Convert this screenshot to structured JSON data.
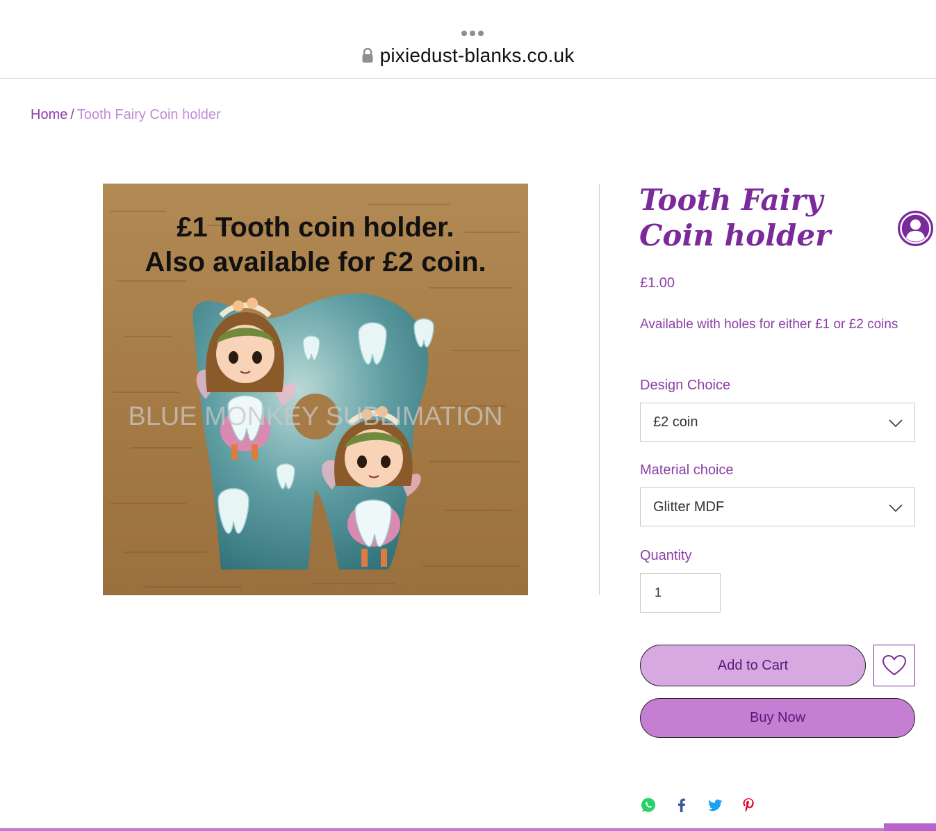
{
  "browser": {
    "url": "pixiedust-blanks.co.uk"
  },
  "breadcrumb": {
    "home": "Home",
    "separator": "/",
    "current": "Tooth Fairy Coin holder"
  },
  "product": {
    "image_text_line1": "£1 Tooth coin holder.",
    "image_text_line2": "Also available for £2 coin.",
    "watermark": "BLUE MONKEY SUBLIMATION",
    "title": "Tooth Fairy Coin holder",
    "price": "£1.00",
    "description": "Available with holes for either £1 or £2 coins"
  },
  "options": {
    "design_label": "Design Choice",
    "design_value": "£2 coin",
    "material_label": "Material choice",
    "material_value": "Glitter MDF",
    "quantity_label": "Quantity",
    "quantity_value": "1"
  },
  "actions": {
    "add_to_cart": "Add to Cart",
    "buy_now": "Buy Now"
  },
  "share": [
    "whatsapp-icon",
    "facebook-icon",
    "twitter-icon",
    "pinterest-icon"
  ],
  "colors": {
    "brand_purple": "#8b3fa6",
    "title_purple": "#7a2a9a",
    "add_cart_bg": "#d8a8e0",
    "buy_now_bg": "#c47fd2"
  }
}
